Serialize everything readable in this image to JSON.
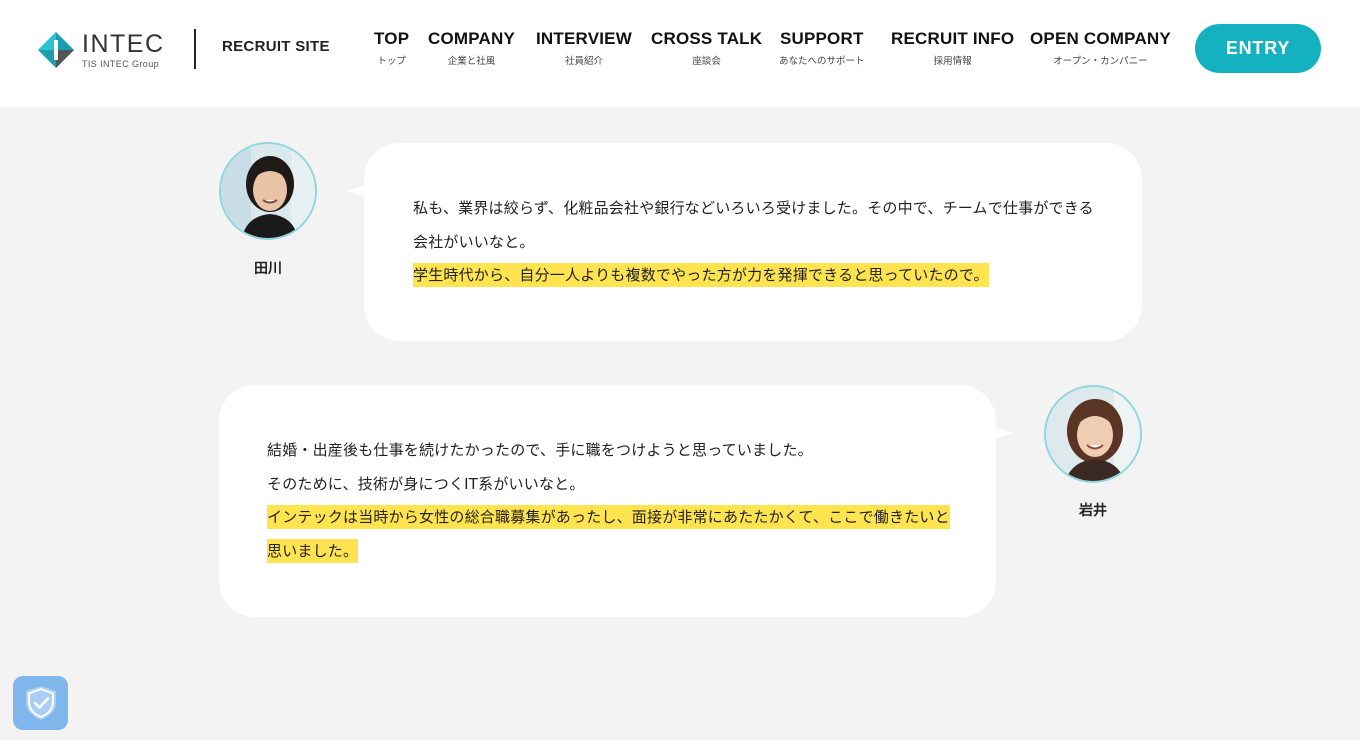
{
  "header": {
    "logo": {
      "name": "INTEC",
      "subtitle": "TIS INTEC Group"
    },
    "site_label": "RECRUIT SITE",
    "nav": [
      {
        "label": "TOP",
        "sub": "トップ"
      },
      {
        "label": "COMPANY",
        "sub": "企業と社風"
      },
      {
        "label": "INTERVIEW",
        "sub": "社員紹介"
      },
      {
        "label": "CROSS TALK",
        "sub": "座談会"
      },
      {
        "label": "SUPPORT",
        "sub": "あなたへのサポート"
      },
      {
        "label": "RECRUIT INFO",
        "sub": "採用情報"
      },
      {
        "label": "OPEN COMPANY",
        "sub": "オープン・カンパニー"
      }
    ],
    "entry_label": "ENTRY"
  },
  "conversation": [
    {
      "speaker": "田川",
      "lines": [
        "私も、業界は絞らず、化粧品会社や銀行などいろいろ受けました。その中で、チームで仕事ができる",
        "会社がいいなと。"
      ],
      "highlight": [
        "学生時代から、自分一人よりも複数でやった方が力を発揮できると思っていたので。"
      ]
    },
    {
      "speaker": "岩井",
      "lines": [
        "結婚・出産後も仕事を続けたかったので、手に職をつけようと思っていました。",
        "そのために、技術が身につくIT系がいいなと。"
      ],
      "highlight": [
        "インテックは当時から女性の総合職募集があったし、面接が非常にあたたかくて、ここで働きたいと",
        "思いました。"
      ]
    }
  ],
  "colors": {
    "accent": "#14b2c0",
    "highlight": "#ffe44f",
    "background": "#f3f3f3",
    "avatar_ring": "#8fd7de",
    "privacy_badge": "#7fb6ec"
  },
  "icons": {
    "logo": "intec-logo-icon",
    "privacy": "shield-check-icon"
  }
}
